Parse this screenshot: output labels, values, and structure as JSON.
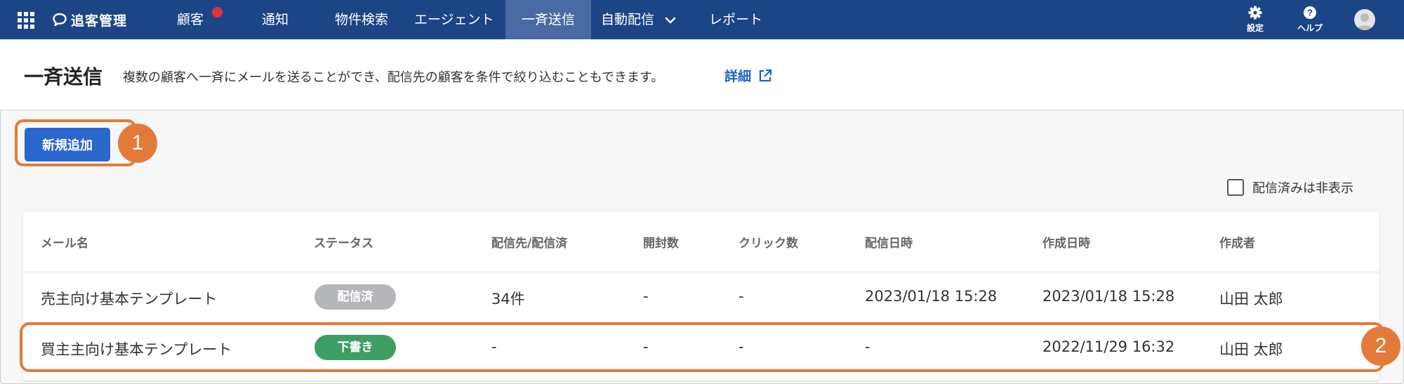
{
  "nav": {
    "app_name": "追客管理",
    "items": [
      {
        "label": "顧客",
        "badge": true
      },
      {
        "label": "通知"
      },
      {
        "label": "物件検索"
      },
      {
        "label": "エージェント"
      },
      {
        "label": "一斉送信",
        "active": true
      },
      {
        "label": "自動配信",
        "dropdown": true
      },
      {
        "label": "レポート"
      }
    ],
    "settings_label": "設定",
    "help_label": "ヘルプ",
    "icons": {
      "apps": "grid-icon",
      "logo": "chat-bubble-icon",
      "settings": "gear-icon",
      "help": "question-circle-icon",
      "avatar": "user-avatar-icon"
    }
  },
  "header": {
    "title": "一斉送信",
    "description": "複数の顧客へ一斉にメールを送ることができ、配信先の顧客を条件で絞り込むこともできます。",
    "detail_link": "詳細"
  },
  "actions": {
    "add_button": "新規追加",
    "hide_sent_label": "配信済みは非表示",
    "hide_sent_checked": false
  },
  "callouts": [
    "1",
    "2"
  ],
  "table": {
    "columns": [
      "メール名",
      "ステータス",
      "配信先/配信済",
      "開封数",
      "クリック数",
      "配信日時",
      "作成日時",
      "作成者"
    ],
    "rows": [
      {
        "name": "売主向け基本テンプレート",
        "status": "配信済",
        "recipients": "34件",
        "opens": "-",
        "clicks": "-",
        "sent_at": "2023/01/18 15:28",
        "created_at": "2023/01/18 15:28",
        "author": "山田 太郎"
      },
      {
        "name": "買主主向け基本テンプレート",
        "status": "下書き",
        "recipients": "-",
        "opens": "-",
        "clicks": "-",
        "sent_at": "-",
        "created_at": "2022/11/29 16:32",
        "author": "山田 太郎"
      }
    ]
  },
  "colors": {
    "nav_bg": "#1c4586",
    "nav_active": "#4a6aa3",
    "primary": "#2a67cd",
    "link": "#1a63c7",
    "callout": "#e47a3a",
    "status_sent": "#b4b6b9",
    "status_draft": "#3d9e63",
    "badge": "#e8303a"
  }
}
